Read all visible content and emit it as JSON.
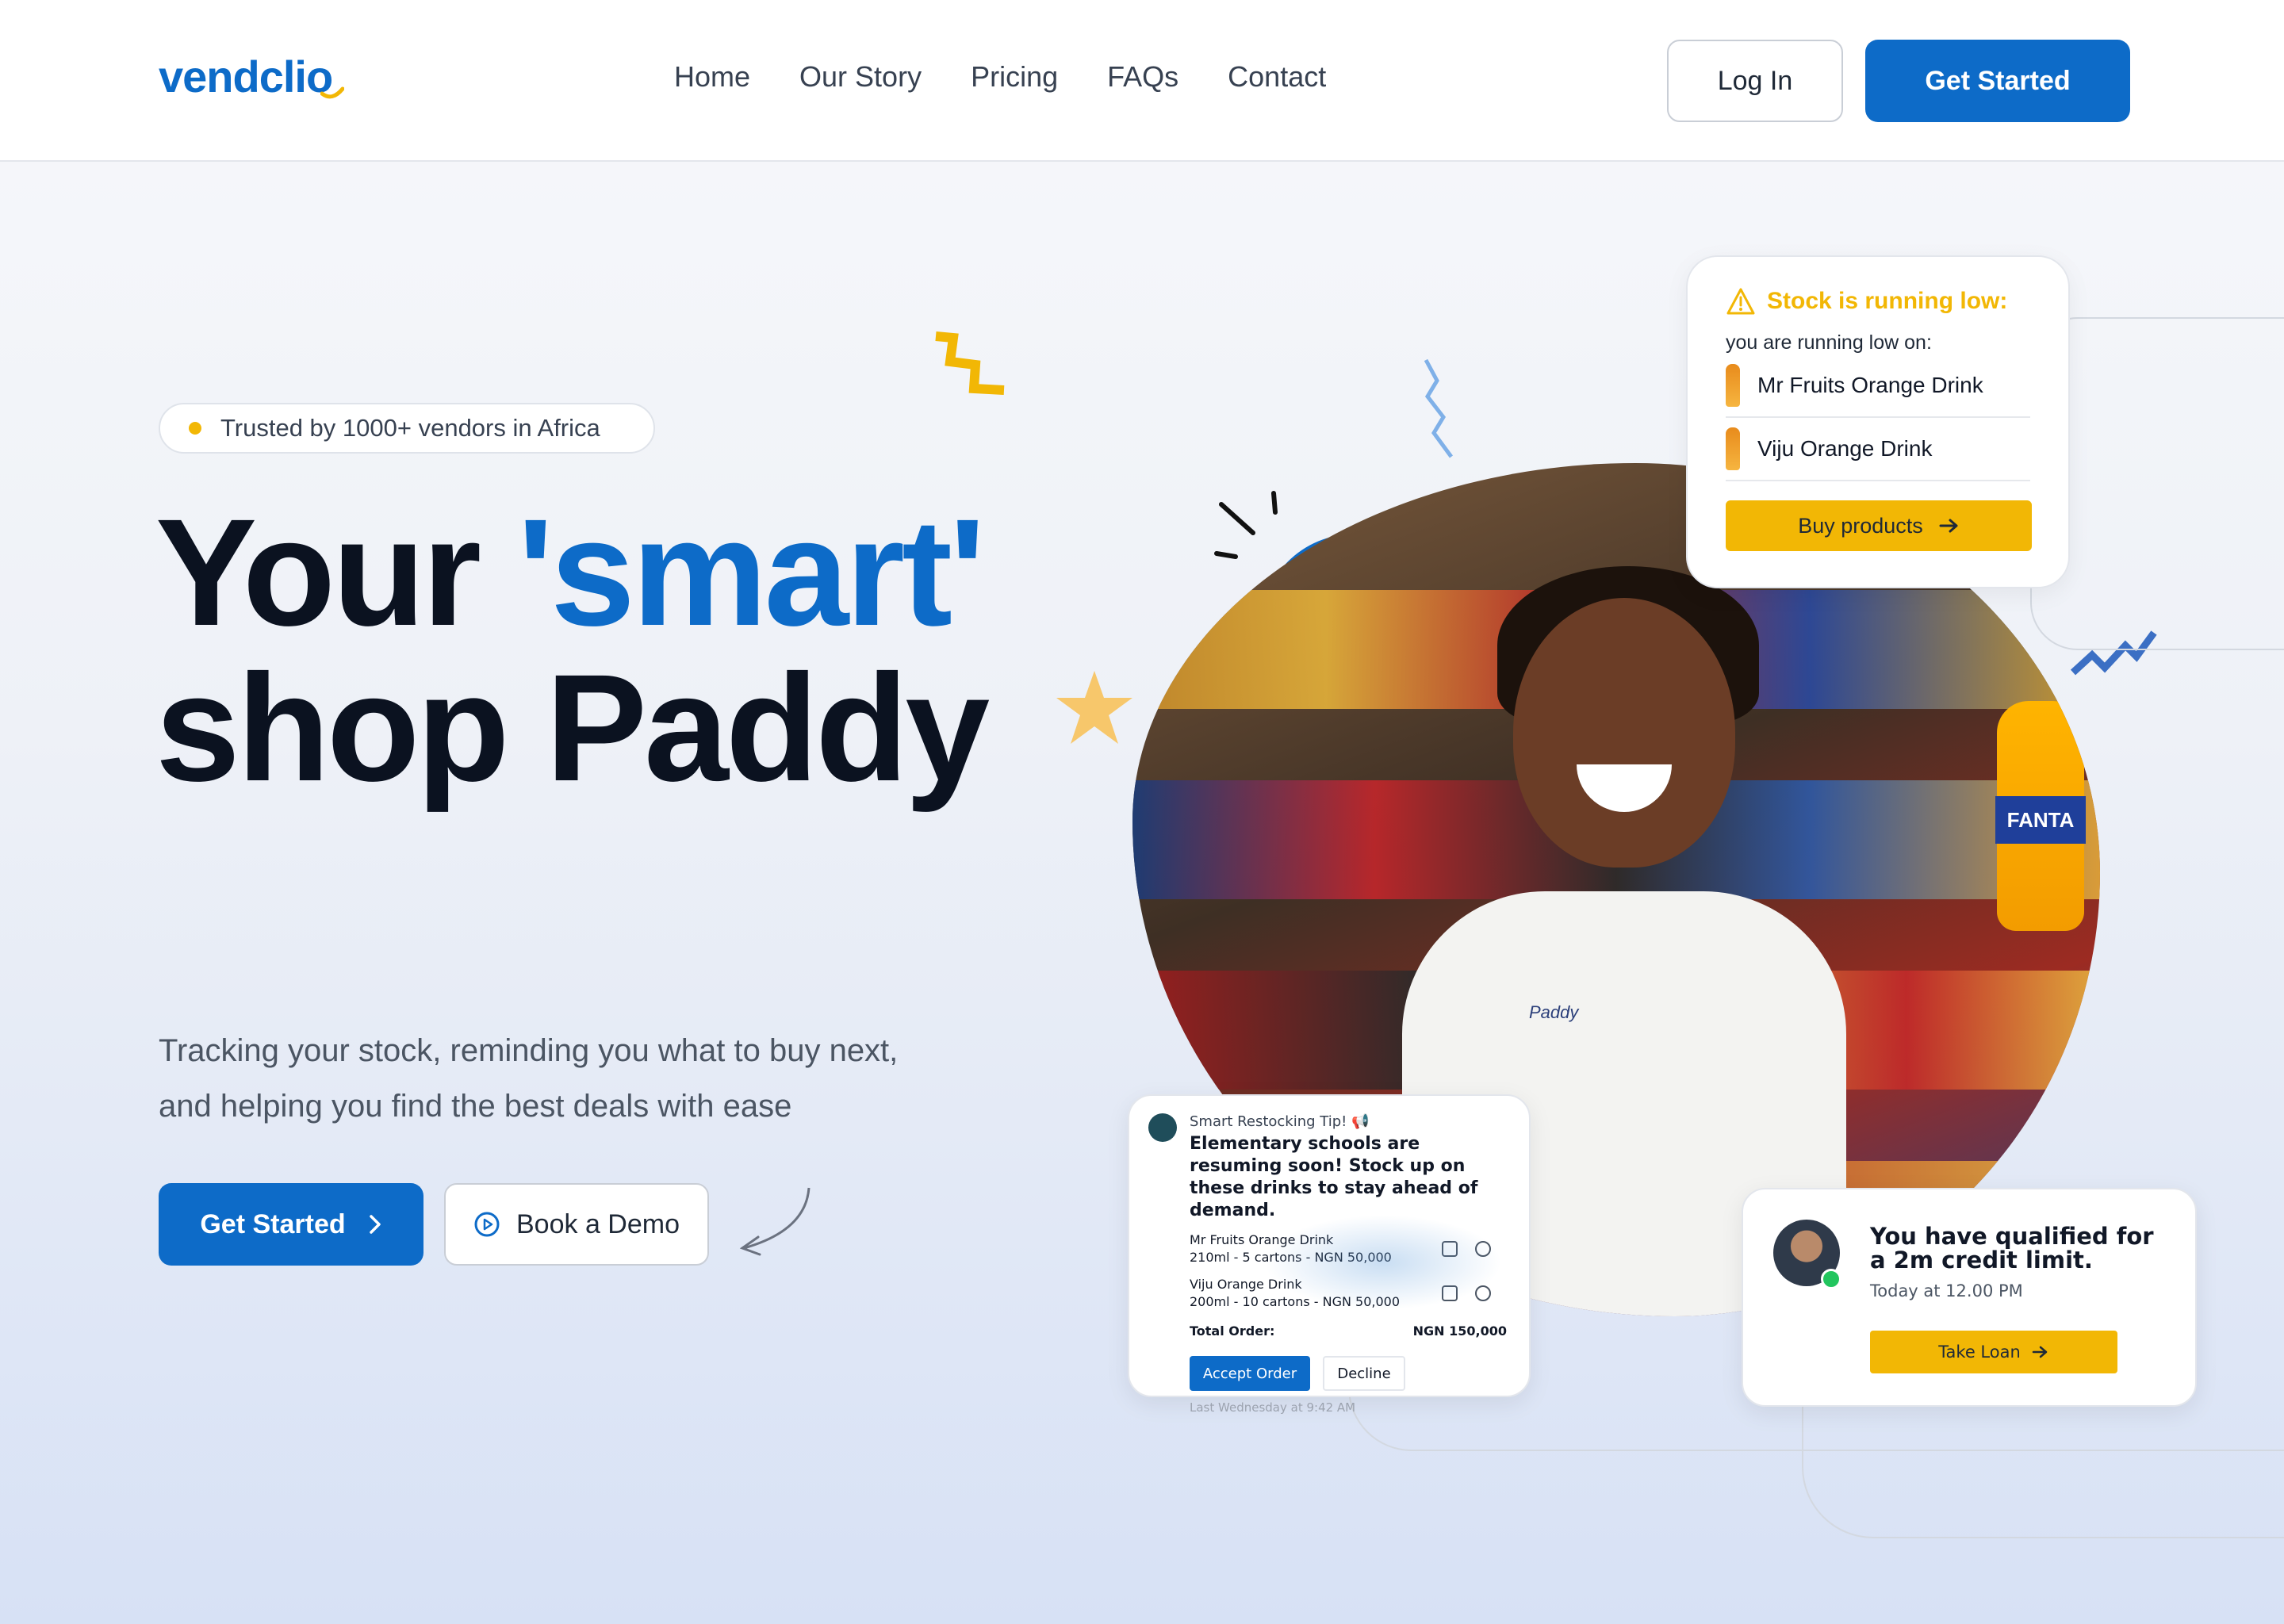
{
  "header": {
    "logo": "vendclio",
    "nav": [
      "Home",
      "Our Story",
      "Pricing",
      "FAQs",
      "Contact"
    ],
    "login_label": "Log In",
    "get_started_label": "Get Started"
  },
  "hero": {
    "badge": "Trusted by 1000+ vendors in Africa",
    "headline_part1": "Your",
    "headline_accent": "'smart'",
    "headline_part2": "shop Paddy",
    "subtext": "Tracking your stock, reminding you what to buy next, and helping you find the best deals with ease",
    "primary_cta": "Get Started",
    "secondary_cta": "Book a Demo"
  },
  "stock_card": {
    "title": "Stock is running low:",
    "subtitle": "you are running low on:",
    "items": [
      "Mr Fruits Orange Drink",
      "Viju Orange Drink"
    ],
    "button": "Buy products"
  },
  "restock_card": {
    "kicker": "Smart Restocking Tip! 📢",
    "title": "Elementary schools are resuming soon! Stock up on these drinks to stay ahead of demand.",
    "items": [
      {
        "name": "Mr Fruits Orange Drink",
        "detail": "210ml - 5 cartons - NGN 50,000"
      },
      {
        "name": "Viju Orange Drink",
        "detail": "200ml - 10 cartons - NGN 50,000"
      }
    ],
    "total_label": "Total Order:",
    "total_value": "NGN 150,000",
    "accept": "Accept Order",
    "decline": "Decline",
    "time": "Last Wednesday at 9:42 AM"
  },
  "loan_card": {
    "title": "You have qualified for a 2m credit limit.",
    "time": "Today at 12.00 PM",
    "button": "Take Loan"
  },
  "photo": {
    "shirt_text": "Paddy",
    "bottle_label": "FANTA"
  },
  "colors": {
    "brand_blue": "#0d6bc8",
    "accent_yellow": "#f2b705",
    "text_dark": "#0b1220"
  }
}
